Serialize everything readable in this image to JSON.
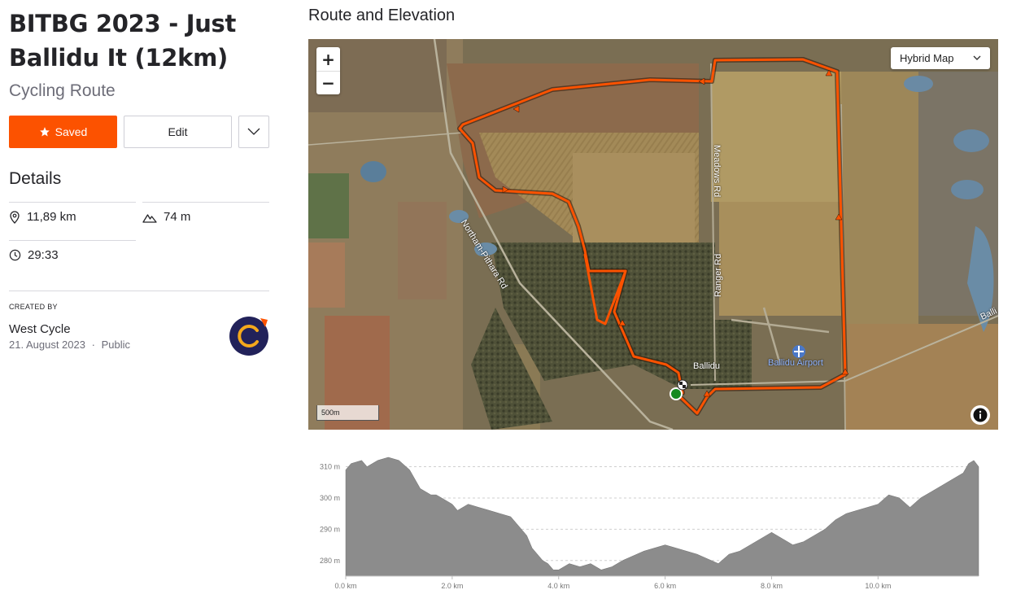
{
  "route": {
    "title": "BITBG 2023 - Just Ballidu It (12km)",
    "type": "Cycling Route"
  },
  "actions": {
    "saved_label": "Saved",
    "edit_label": "Edit"
  },
  "details": {
    "heading": "Details",
    "distance": "11,89 km",
    "elevation_gain": "74 m",
    "time": "29:33"
  },
  "created": {
    "label": "CREATED BY",
    "name": "West Cycle",
    "date": "21. August 2023",
    "separator": "·",
    "visibility": "Public"
  },
  "section": {
    "title": "Route and Elevation"
  },
  "map": {
    "zoom_in": "+",
    "zoom_out": "−",
    "map_type": "Hybrid Map",
    "scale": "500m",
    "info_icon": "i",
    "labels": {
      "road1": "Northam-Pithara Rd",
      "road2": "Meadows Rd",
      "road3": "Ranger Rd",
      "town": "Ballidu",
      "airport": "Ballidu Airport",
      "edge_road": "Balli"
    }
  },
  "colors": {
    "accent": "#fc5200",
    "route_line": "#fc5200",
    "elevation_fill": "#8c8c8c"
  },
  "chart_data": {
    "type": "area",
    "xlabel": "",
    "ylabel": "",
    "xlim": [
      0,
      11.89
    ],
    "ylim": [
      275,
      313
    ],
    "x_ticks": [
      "0.0 km",
      "2.0 km",
      "4.0 km",
      "6.0 km",
      "8.0 km",
      "10.0 km"
    ],
    "y_ticks": [
      "280 m",
      "290 m",
      "300 m",
      "310 m"
    ],
    "grid": true,
    "series": [
      {
        "x": [
          0,
          0.1,
          0.3,
          0.4,
          0.6,
          0.8,
          1.0,
          1.2,
          1.4,
          1.6,
          1.7,
          1.8,
          2.0,
          2.1,
          2.3,
          2.5,
          2.7,
          2.9,
          3.1,
          3.2,
          3.4,
          3.5,
          3.7,
          3.8,
          3.9,
          4.0,
          4.2,
          4.4,
          4.6,
          4.8,
          5.0,
          5.2,
          5.6,
          6.0,
          6.2,
          6.6,
          7.0,
          7.2,
          7.4,
          7.6,
          7.8,
          8.0,
          8.2,
          8.4,
          8.6,
          8.8,
          9.0,
          9.2,
          9.4,
          9.6,
          9.8,
          10.0,
          10.2,
          10.4,
          10.6,
          10.8,
          11.0,
          11.2,
          11.4,
          11.6,
          11.7,
          11.8,
          11.89
        ],
        "y": [
          309,
          311,
          312,
          310,
          312,
          313,
          312,
          309,
          303,
          301,
          301,
          300,
          298,
          296,
          298,
          297,
          296,
          295,
          294,
          292,
          288,
          284,
          280,
          279,
          277,
          277,
          279,
          278,
          279,
          277,
          278,
          280,
          283,
          285,
          284,
          282,
          279,
          282,
          283,
          285,
          287,
          289,
          287,
          285,
          286,
          288,
          290,
          293,
          295,
          296,
          297,
          298,
          301,
          300,
          297,
          300,
          302,
          304,
          306,
          308,
          311,
          312,
          310
        ]
      }
    ]
  }
}
